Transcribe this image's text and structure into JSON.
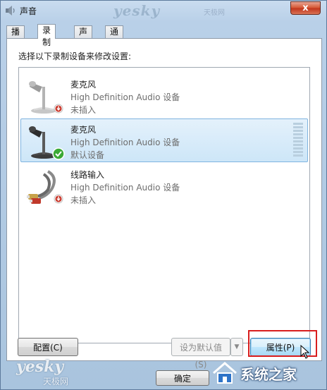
{
  "window": {
    "title": "声音",
    "close_label": "x"
  },
  "watermarks": {
    "top_logo": "yesky",
    "top_sub": "天极网",
    "bottom_logo": "yesky",
    "bottom_sub": "天极网"
  },
  "tabs": [
    {
      "label": "播放",
      "active": false
    },
    {
      "label": "录制",
      "active": true
    },
    {
      "label": "声音",
      "active": false
    },
    {
      "label": "通信",
      "active": false
    }
  ],
  "instruction": "选择以下录制设备来修改设置:",
  "devices": [
    {
      "name": "麦克风",
      "description": "High Definition Audio 设备",
      "status": "未插入",
      "icon": "microphone-icon",
      "badge": "unplugged-badge-icon",
      "selected": false
    },
    {
      "name": "麦克风",
      "description": "High Definition Audio 设备",
      "status": "默认设备",
      "icon": "microphone-icon",
      "badge": "default-check-badge-icon",
      "selected": true
    },
    {
      "name": "线路输入",
      "description": "High Definition Audio 设备",
      "status": "未插入",
      "icon": "line-in-cable-icon",
      "badge": "unplugged-badge-icon",
      "selected": false
    }
  ],
  "buttons": {
    "configure": "配置(C)",
    "set_default": "设为默认值(S)",
    "properties": "属性(P)",
    "ok": "确定"
  },
  "site": {
    "brand_text": "系统之家"
  },
  "colors": {
    "accent_selection": "#cde6f8",
    "highlight_box": "#d81e1e",
    "close_button": "#c1341b"
  }
}
